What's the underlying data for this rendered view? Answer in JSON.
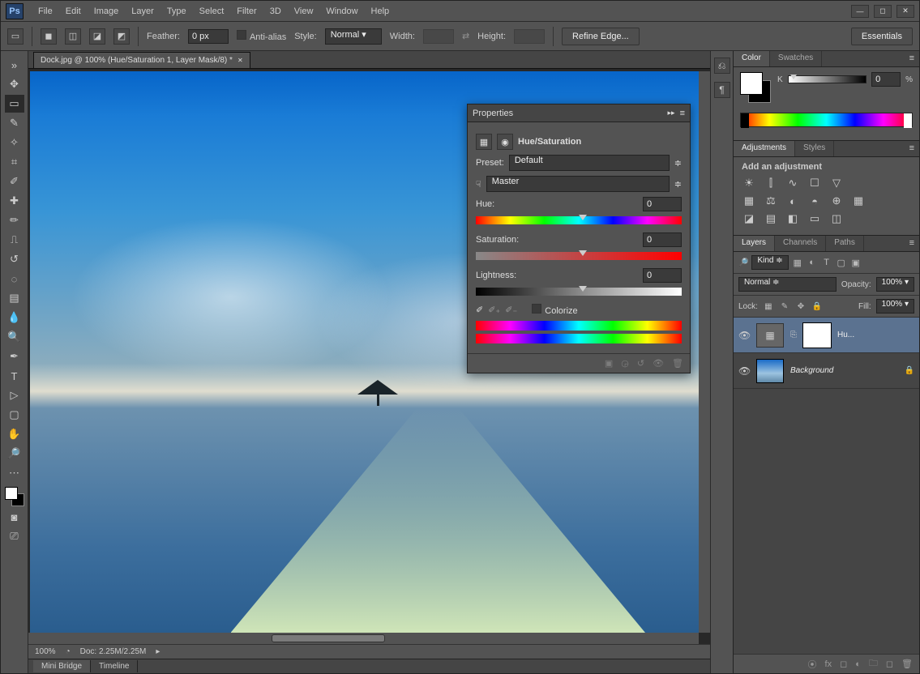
{
  "app": {
    "logo": "Ps"
  },
  "menu": {
    "items": [
      "File",
      "Edit",
      "Image",
      "Layer",
      "Type",
      "Select",
      "Filter",
      "3D",
      "View",
      "Window",
      "Help"
    ]
  },
  "options": {
    "feather_label": "Feather:",
    "feather_value": "0 px",
    "antialias_label": "Anti-alias",
    "style_label": "Style:",
    "style_value": "Normal",
    "width_label": "Width:",
    "height_label": "Height:",
    "refine_label": "Refine Edge...",
    "essentials_label": "Essentials"
  },
  "document": {
    "tab_title": "Dock.jpg @ 100% (Hue/Saturation 1, Layer Mask/8) *",
    "zoom": "100%",
    "doc_info": "Doc: 2.25M/2.25M"
  },
  "properties": {
    "panel_title": "Properties",
    "adjustment_title": "Hue/Saturation",
    "preset_label": "Preset:",
    "preset_value": "Default",
    "channel_value": "Master",
    "hue_label": "Hue:",
    "hue_value": "0",
    "sat_label": "Saturation:",
    "sat_value": "0",
    "light_label": "Lightness:",
    "light_value": "0",
    "colorize_label": "Colorize"
  },
  "color_panel": {
    "tab_color": "Color",
    "tab_swatches": "Swatches",
    "k_label": "K",
    "k_value": "0",
    "k_unit": "%"
  },
  "adjustments_panel": {
    "tab_adjustments": "Adjustments",
    "tab_styles": "Styles",
    "heading": "Add an adjustment"
  },
  "layers_panel": {
    "tab_layers": "Layers",
    "tab_channels": "Channels",
    "tab_paths": "Paths",
    "kind_label": "Kind",
    "blend_mode": "Normal",
    "opacity_label": "Opacity:",
    "opacity_value": "100%",
    "lock_label": "Lock:",
    "fill_label": "Fill:",
    "fill_value": "100%",
    "layer1_name": "Hu...",
    "layer2_name": "Background"
  },
  "bottom_tabs": {
    "mini_bridge": "Mini Bridge",
    "timeline": "Timeline"
  }
}
